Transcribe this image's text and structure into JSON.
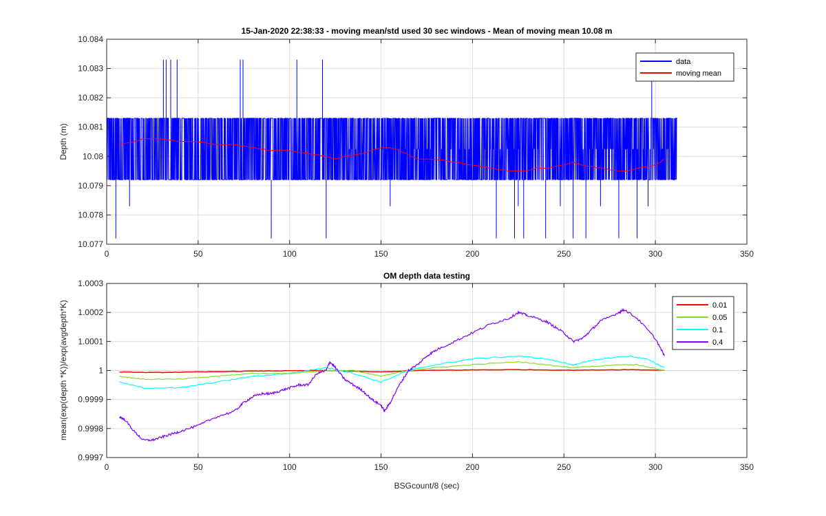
{
  "chart_data": [
    {
      "type": "line",
      "title": "15-Jan-2020 22:38:33 - moving mean/std used 30 sec windows - Mean of moving mean 10.08 m",
      "xlabel": "",
      "ylabel": "Depth (m)",
      "xlim": [
        0,
        350
      ],
      "ylim": [
        10.077,
        10.084
      ],
      "xticks": [
        "0",
        "50",
        "100",
        "150",
        "200",
        "250",
        "300",
        "350"
      ],
      "yticks": [
        "10.077",
        "10.078",
        "10.079",
        "10.08",
        "10.081",
        "10.082",
        "10.083",
        "10.084"
      ],
      "grid": true,
      "legend_position": "top-right",
      "data_range": {
        "x": [
          0,
          312
        ],
        "levels": [
          10.0772,
          10.0783,
          10.0792,
          10.0813,
          10.0826,
          10.0833
        ]
      },
      "series": [
        {
          "name": "data",
          "color": "#0000ff",
          "spikes_up_x": [
            31,
            32.5,
            35,
            38.5,
            73,
            74.5,
            104,
            118,
            298
          ],
          "spikes_down_x": [
            5,
            12.5,
            90,
            120,
            155,
            213,
            223,
            225,
            228,
            240,
            248,
            255,
            262,
            270,
            280,
            290,
            296
          ]
        },
        {
          "name": "moving mean",
          "color": "#ff0000",
          "x": [
            7,
            15,
            20,
            25,
            30,
            40,
            50,
            60,
            70,
            80,
            90,
            100,
            110,
            120,
            125,
            130,
            140,
            150,
            155,
            160,
            170,
            180,
            190,
            200,
            210,
            220,
            230,
            235,
            240,
            250,
            255,
            260,
            270,
            280,
            285,
            290,
            300,
            305
          ],
          "values": [
            10.0804,
            10.0805,
            10.0806,
            10.0806,
            10.0806,
            10.0805,
            10.0805,
            10.0804,
            10.0804,
            10.0803,
            10.0802,
            10.0802,
            10.0801,
            10.08,
            10.0799,
            10.08,
            10.0801,
            10.0803,
            10.0803,
            10.0802,
            10.0799,
            10.0799,
            10.0798,
            10.0797,
            10.0796,
            10.0795,
            10.0795,
            10.0796,
            10.0796,
            10.0797,
            10.0798,
            10.0797,
            10.0796,
            10.0795,
            10.0795,
            10.0796,
            10.0797,
            10.0799
          ]
        }
      ]
    },
    {
      "type": "line",
      "title": "OM depth data testing",
      "xlabel": "BSGcount/8 (sec)",
      "ylabel": "mean(exp(depth *K))/exp(avgdepth*K)",
      "xlim": [
        0,
        350
      ],
      "ylim": [
        0.9997,
        1.0003
      ],
      "xticks": [
        "0",
        "50",
        "100",
        "150",
        "200",
        "250",
        "300",
        "350"
      ],
      "yticks": [
        "0.9997",
        "0.9998",
        "0.9999",
        "1",
        "1.0001",
        "1.0002",
        "1.0003"
      ],
      "grid": true,
      "legend_position": "top-right",
      "series": [
        {
          "name": "0.01",
          "color": "#ff0000",
          "x": [
            7,
            25,
            50,
            80,
            100,
            120,
            150,
            170,
            200,
            225,
            255,
            285,
            305
          ],
          "values": [
            0.999995,
            0.999993,
            0.999995,
            0.999998,
            0.999999,
            1.0,
            0.999995,
            1.0,
            1.000002,
            1.000003,
            1.000001,
            1.000003,
            1.000001
          ]
        },
        {
          "name": "0.05",
          "color": "#80e020",
          "x": [
            7,
            20,
            40,
            60,
            80,
            100,
            120,
            135,
            150,
            165,
            180,
            200,
            225,
            255,
            280,
            290,
            305
          ],
          "values": [
            0.99998,
            0.99997,
            0.99997,
            0.99998,
            0.99999,
            0.99999,
            1.0,
            1.0,
            0.99998,
            1.0,
            1.00001,
            1.00002,
            1.00003,
            1.00001,
            1.00002,
            1.00002,
            1.0
          ]
        },
        {
          "name": "0.1",
          "color": "#00ffff",
          "x": [
            7,
            20,
            40,
            60,
            80,
            100,
            120,
            135,
            150,
            165,
            180,
            200,
            225,
            240,
            255,
            270,
            285,
            295,
            305
          ],
          "values": [
            0.99996,
            0.99994,
            0.99994,
            0.99996,
            0.99998,
            0.99999,
            1.00001,
            0.99999,
            0.99996,
            1.0,
            1.00002,
            1.00004,
            1.00005,
            1.00004,
            1.00002,
            1.00004,
            1.00005,
            1.00004,
            1.00001
          ]
        },
        {
          "name": "0.4",
          "color": "#8000ff",
          "x": [
            7,
            10,
            15,
            20,
            25,
            30,
            35,
            40,
            50,
            60,
            70,
            75,
            80,
            85,
            90,
            95,
            100,
            105,
            110,
            115,
            120,
            122,
            125,
            130,
            135,
            140,
            145,
            150,
            152,
            155,
            160,
            165,
            170,
            175,
            180,
            190,
            200,
            210,
            220,
            225,
            230,
            240,
            245,
            250,
            255,
            260,
            265,
            270,
            280,
            283,
            290,
            300,
            305
          ],
          "values": [
            0.99984,
            0.99983,
            0.99979,
            0.99976,
            0.99976,
            0.99977,
            0.99978,
            0.99979,
            0.99981,
            0.99984,
            0.99986,
            0.99989,
            0.99991,
            0.99992,
            0.99992,
            0.99993,
            0.99994,
            0.99995,
            0.99995,
            0.99999,
            1.0,
            1.00003,
            1.00001,
            0.99997,
            0.99995,
            0.99993,
            0.9999,
            0.99988,
            0.99986,
            0.99989,
            0.99995,
            1.0,
            1.00002,
            1.00005,
            1.00007,
            1.0001,
            1.00013,
            1.00016,
            1.00018,
            1.0002,
            1.00019,
            1.00017,
            1.00015,
            1.00013,
            1.0001,
            1.00011,
            1.00014,
            1.00017,
            1.0002,
            1.00021,
            1.00018,
            1.00011,
            1.00005
          ]
        }
      ]
    }
  ]
}
